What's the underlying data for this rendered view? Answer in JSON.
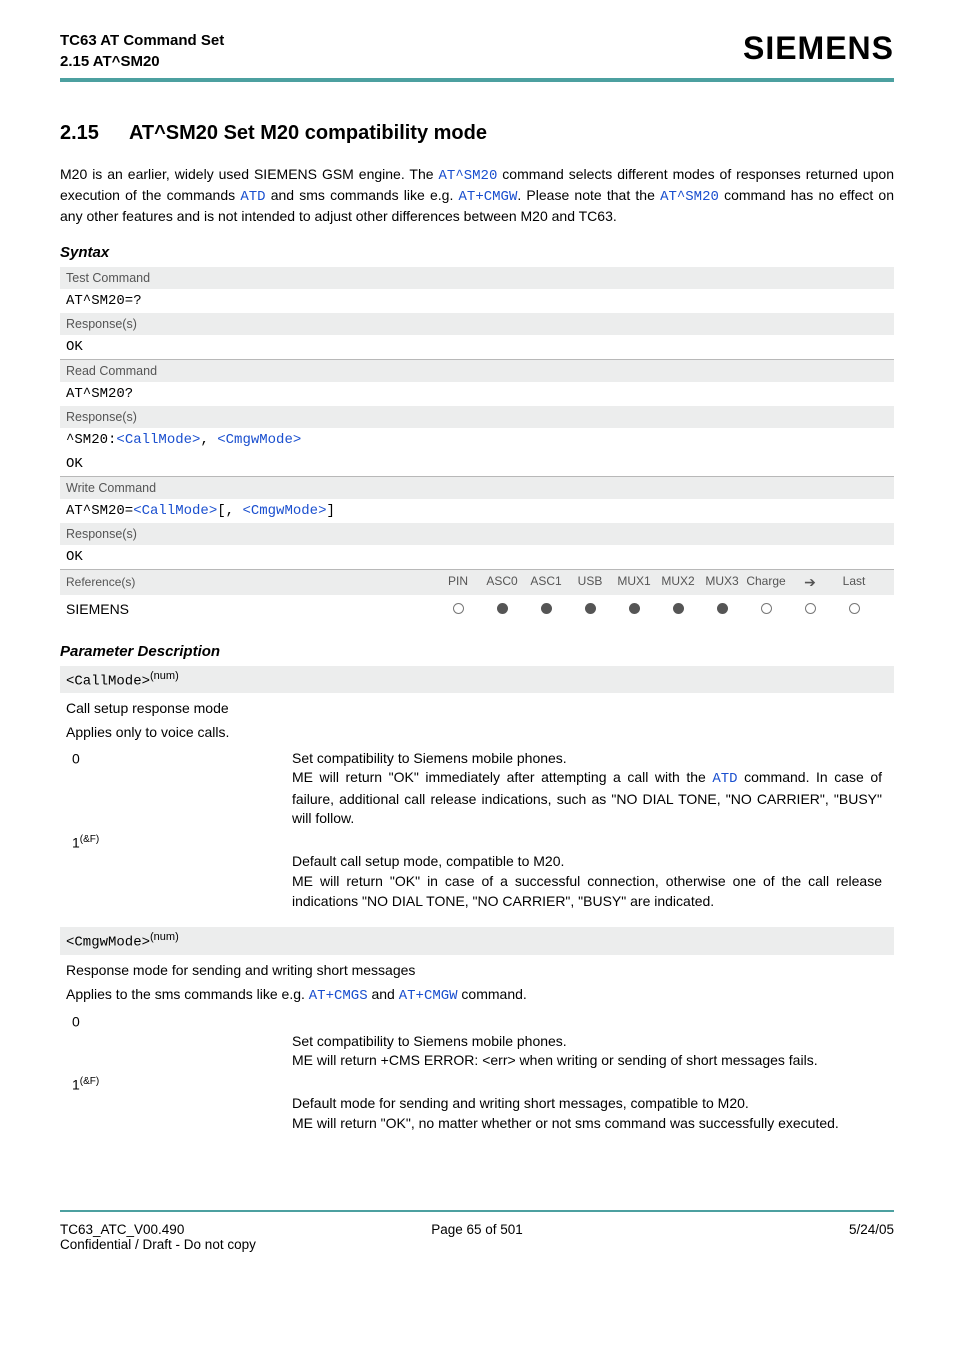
{
  "header": {
    "doc_title": "TC63 AT Command Set",
    "subtitle": "2.15 AT^SM20",
    "brand": "SIEMENS"
  },
  "section": {
    "number": "2.15",
    "title": "AT^SM20   Set M20 compatibility mode"
  },
  "intro": {
    "t1": "M20 is an earlier, widely used SIEMENS GSM engine. The ",
    "c1": "AT^SM20",
    "t2": " command selects different modes of responses returned upon execution of the commands ",
    "c2": "ATD",
    "t3": " and sms commands like e.g. ",
    "c3": "AT+CMGW",
    "t4": ". Please note that the ",
    "c4": "AT^SM20",
    "t5": " command has no effect on any other features and is not intended to adjust other differences between M20 and TC63."
  },
  "syntax": {
    "heading": "Syntax",
    "test_label": "Test Command",
    "test_cmd": "AT^SM20=?",
    "resp_label": "Response(s)",
    "ok": "OK",
    "read_label": "Read Command",
    "read_cmd": "AT^SM20?",
    "read_resp_prefix": "^SM20:",
    "p_call": "<CallMode>",
    "comma": ", ",
    "p_cmgw": "<CmgwMode>",
    "write_label": "Write Command",
    "write_prefix": "AT^SM20=",
    "lbr": "[",
    "rbr": "]",
    "ref_label": "Reference(s)",
    "ref_cols": [
      "PIN",
      "ASC0",
      "ASC1",
      "USB",
      "MUX1",
      "MUX2",
      "MUX3",
      "Charge",
      "➔",
      "Last"
    ],
    "ref_vendor": "SIEMENS",
    "ref_states": [
      "open",
      "fill",
      "fill",
      "fill",
      "fill",
      "fill",
      "fill",
      "open",
      "open",
      "open"
    ]
  },
  "param_desc": {
    "heading": "Parameter Description",
    "call": {
      "name": "<CallMode>",
      "sup": "(num)",
      "line1": "Call setup response mode",
      "line2": "Applies only to voice calls.",
      "vals": [
        {
          "k": "0",
          "sup": "",
          "d_pre": "Set compatibility to Siemens mobile phones.\nME will return \"OK\" immediately after attempting a call with the ",
          "d_cmd": "ATD",
          "d_post": " command. In case of failure, additional call release indications, such as \"NO DIAL TONE, \"NO CARRIER\", \"BUSY\" will follow."
        },
        {
          "k": "1",
          "sup": "(&F)",
          "d_pre": "Default call setup mode, compatible to M20.\nME will return \"OK\" in case of a successful connection, otherwise one of the call release indications \"NO DIAL TONE, \"NO CARRIER\", \"BUSY\" are indicated.",
          "d_cmd": "",
          "d_post": ""
        }
      ]
    },
    "cmgw": {
      "name": "<CmgwMode>",
      "sup": "(num)",
      "line1": "Response mode for sending and writing short messages",
      "line2_pre": "Applies to the sms commands like e.g. ",
      "line2_c1": "AT+CMGS",
      "line2_mid": " and ",
      "line2_c2": "AT+CMGW",
      "line2_post": " command.",
      "vals": [
        {
          "k": "0",
          "sup": "",
          "d": "Set compatibility to Siemens mobile phones.\nME will return +CMS ERROR: <err> when writing or sending of short messages fails."
        },
        {
          "k": "1",
          "sup": "(&F)",
          "d": "Default mode for sending and writing short messages, compatible to M20.\nME will return \"OK\", no matter whether or not sms command was successfully executed."
        }
      ]
    }
  },
  "footer": {
    "left1": "TC63_ATC_V00.490",
    "left2": "Confidential / Draft - Do not copy",
    "center": "Page 65 of 501",
    "right": "5/24/05"
  }
}
